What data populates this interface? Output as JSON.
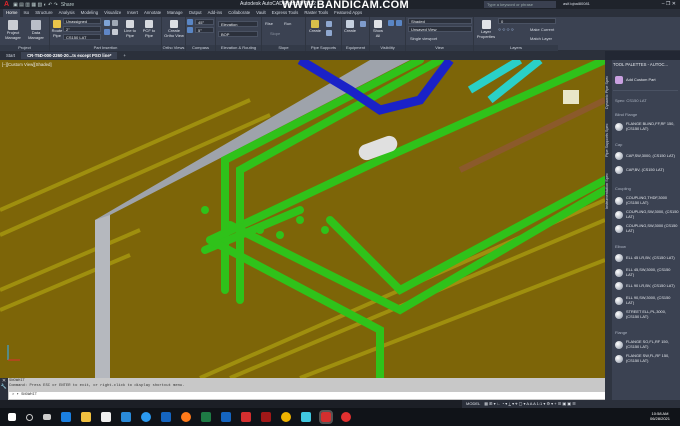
{
  "titlebar": {
    "logo": "A",
    "quick_access": "Share",
    "title": "Autodesk AutoCAD Plant 3D 2022",
    "watermark": "WWW.BANDICAM.COM",
    "search_placeholder": "Type a keyword or phrase",
    "user": "asif.iqbal80081",
    "window_controls": "–  ❐  ✕"
  },
  "ribbon_tabs": [
    "Home",
    "Iso",
    "Structure",
    "Analysis",
    "Modeling",
    "Visualize",
    "Insert",
    "Annotate",
    "Manage",
    "Output",
    "Add-ins",
    "Collaborate",
    "Vault",
    "Express Tools",
    "Raster Tools",
    "Featured Apps"
  ],
  "panels": {
    "project": {
      "label": "Project",
      "buttons": [
        "Project Manager",
        "Data Manager"
      ]
    },
    "part_insertion": {
      "label": "Part Insertion",
      "route_pipe": "Route Pipe",
      "line_to_pipe": "Line to Pipe",
      "pcf_to_pipe": "PCF to Pipe",
      "spec_value": "Unassigned",
      "size_value": "2\"",
      "spec_name": "CS150 LAT"
    },
    "ortho_views": {
      "label": "Ortho Views",
      "button": "Create Ortho View"
    },
    "compass": {
      "label": "Compass",
      "angle1": "45°",
      "angle2": "5°"
    },
    "elevation": {
      "label": "Elevation & Routing",
      "elevation": "Elevation",
      "bop": "BOP"
    },
    "slope": {
      "label": "Slope",
      "rise": "Rise",
      "run": "Run",
      "slope": "Slope"
    },
    "pipe_supports": {
      "label": "Pipe Supports",
      "button": "Create"
    },
    "equipment": {
      "label": "Equipment",
      "button": "Create"
    },
    "visibility": {
      "label": "Visibility",
      "button": "Show All"
    },
    "view": {
      "label": "View",
      "visual_style": "Shaded",
      "view": "Unsaved View",
      "viewport": "Single viewport"
    },
    "layers": {
      "label": "Layers",
      "button": "Layer Properties",
      "layer": "0",
      "make_current": "Make Current",
      "match_layer": "Match Layer"
    }
  },
  "doc_tabs": [
    "Start",
    "CR-T5D-000-2260-20...ts except PSO line*",
    "+"
  ],
  "viewport": {
    "label": "[–][Custom View][Shaded]"
  },
  "palette": {
    "header": "TOOL PALETTES - AUTOC...",
    "side_tabs": [
      "Dynamic Pipe Spec",
      "Pipe Supports Spec",
      "Instrumentation Spec"
    ],
    "add_custom": "Add Custom Part",
    "spec": "Spec: CS150 LAT",
    "groups": [
      {
        "name": "Blind Flange",
        "items": [
          "FLANGE BLIND,FF,RF 150, (CS150 LAT)"
        ]
      },
      {
        "name": "Cap",
        "items": [
          "CAP,SW,3000, (CS150 LAT)",
          "CAP,BV, (CS150 LAT)"
        ]
      },
      {
        "name": "Coupling",
        "items": [
          "COUPLING,THDF,3000 (CS150 LAT)",
          "COUPLING,SW,3000, (CS150 LAT)",
          "COUPLING,SW,3000 (CS150 LAT)"
        ]
      },
      {
        "name": "Elbow",
        "items": [
          "ELL 45 LR,BV, (CS150 LAT)",
          "ELL 45,SW,3000, (CS150 LAT)",
          "ELL 90 LR,BV, (CS150 LAT)",
          "ELL 90,SW,3000, (CS150 LAT)",
          "STREET ELL,PL,3000, (CS150 LAT)"
        ]
      },
      {
        "name": "Flange",
        "items": [
          "FLANGE SO,FL,RF 150, (CS150 LAT)",
          "FLANGE SW,FL,RF 150, (CS150 LAT)"
        ]
      }
    ]
  },
  "command": {
    "history1": "SNOWHIT",
    "history2": "Command: Press ESC or ENTER to exit, or right-click to display shortcut menu.",
    "input": "> ▾ SNOWHIT"
  },
  "status": {
    "model": "MODEL",
    "icons": "▦ ⊞ ▾ ∟ ◔ ▾ ⟂ ▾ ⌖ ▢ ▾ A A A 1:1 ▾ ⚙ ▾ + ☰ ▣ ▣ ☰"
  },
  "taskbar": {
    "time": "10:58 AM",
    "date": "06/28/2021"
  },
  "colors": {
    "pipe_green": "#2fc21a",
    "pipe_blue": "#1a22c8",
    "pipe_cyan": "#2ad0c8",
    "background": "#7d6508"
  }
}
